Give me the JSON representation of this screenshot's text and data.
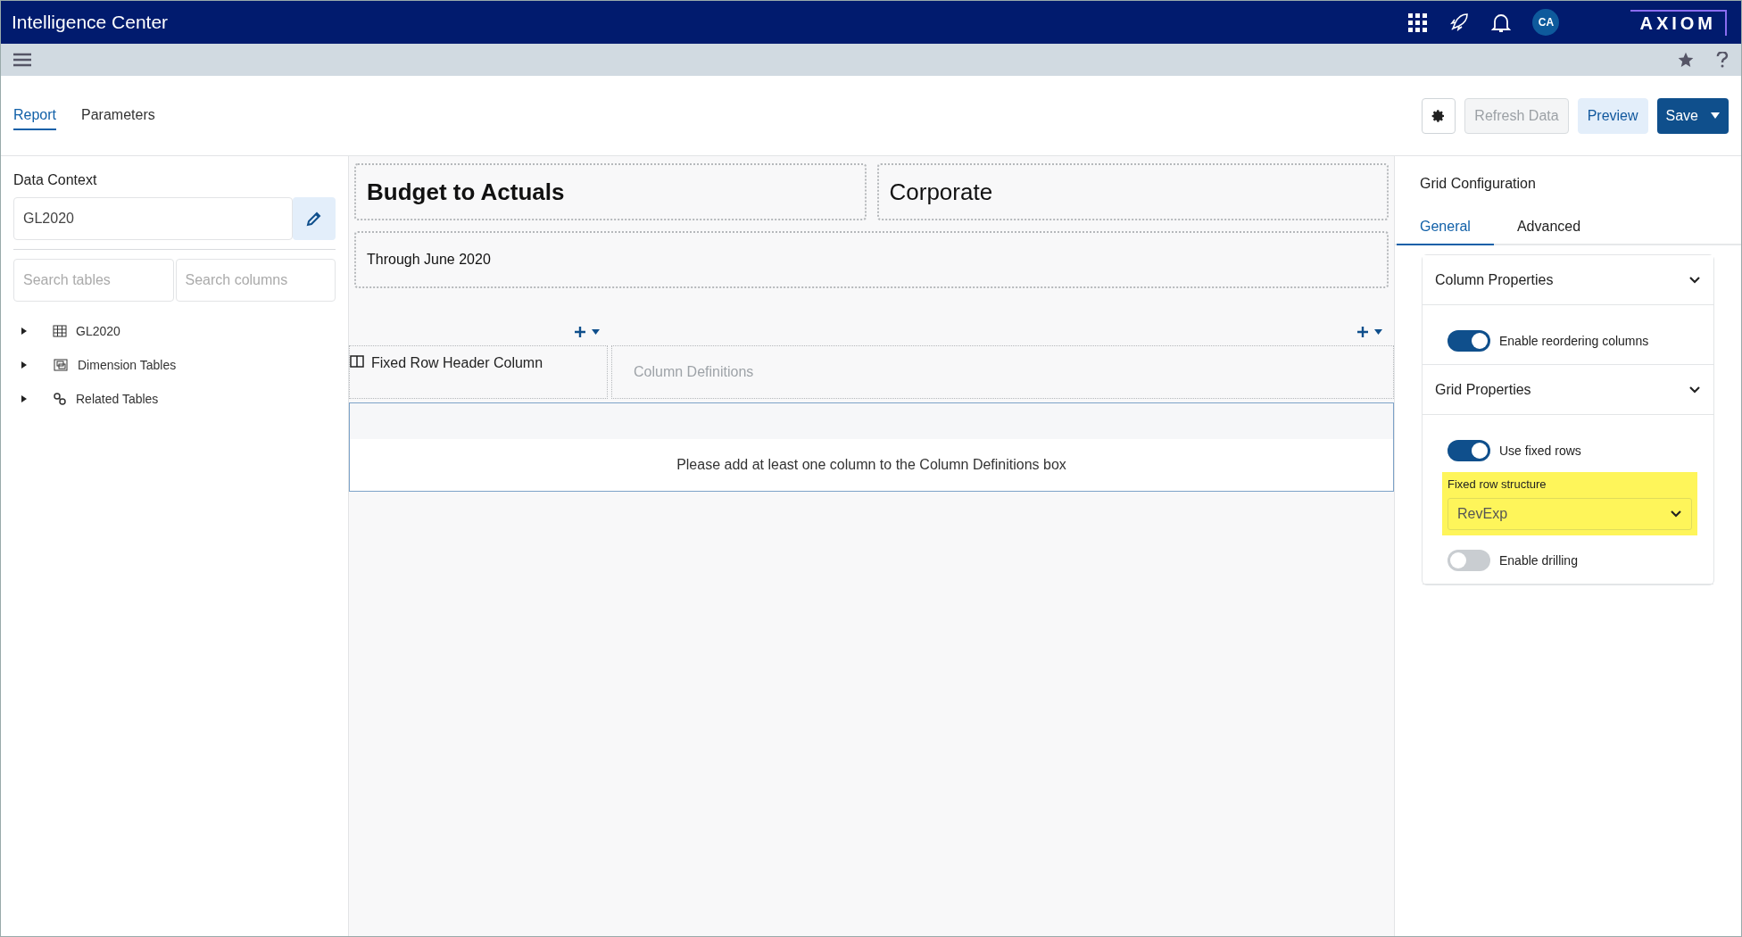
{
  "app_bar": {
    "title": "Intelligence Center",
    "user_initials": "CA",
    "logo": "AXIOM"
  },
  "page_tabs": [
    {
      "label": "Report",
      "selected": true
    },
    {
      "label": "Parameters",
      "selected": false
    }
  ],
  "actions": [
    {
      "kind": "icon",
      "disabled": false
    },
    {
      "kind": "text",
      "label": "Refresh Data",
      "disabled": true
    },
    {
      "kind": "text",
      "label": "Preview",
      "disabled": false
    },
    {
      "kind": "split",
      "label": "Save",
      "disabled": false
    }
  ],
  "data_context": {
    "label": "Data Context",
    "value": "GL2020",
    "search_tables_placeholder": "Search tables",
    "search_columns_placeholder": "Search columns",
    "tree": [
      {
        "label": "GL2020",
        "kind": "table",
        "expanded": false
      },
      {
        "label": "Dimension Tables",
        "kind": "dimension",
        "expanded": false
      },
      {
        "label": "Related Tables",
        "kind": "related",
        "expanded": false
      }
    ]
  },
  "report": {
    "title": "Budget to Actuals",
    "entity": "Corporate",
    "subtitle": "Through June 2020",
    "fixed_row_header": "Fixed Row Header Column",
    "column_definitions_placeholder": "Column Definitions",
    "empty_message": "Please add at least one column to the Column Definitions box"
  },
  "grid_configuration": {
    "title": "Grid Configuration",
    "tabs": [
      {
        "label": "General",
        "selected": true
      },
      {
        "label": "Advanced",
        "selected": false
      }
    ],
    "sections": [
      {
        "title": "Column Properties",
        "expanded": true,
        "settings": [
          {
            "kind": "toggle",
            "label": "Enable reordering columns",
            "on": true
          }
        ]
      },
      {
        "title": "Grid Properties",
        "expanded": true,
        "settings": [
          {
            "kind": "toggle",
            "label": "Use fixed rows",
            "on": true
          },
          {
            "kind": "select",
            "label": "Fixed row structure",
            "value": "RevExp",
            "highlighted": true
          },
          {
            "kind": "toggle",
            "label": "Enable drilling",
            "on": false
          }
        ]
      }
    ]
  }
}
